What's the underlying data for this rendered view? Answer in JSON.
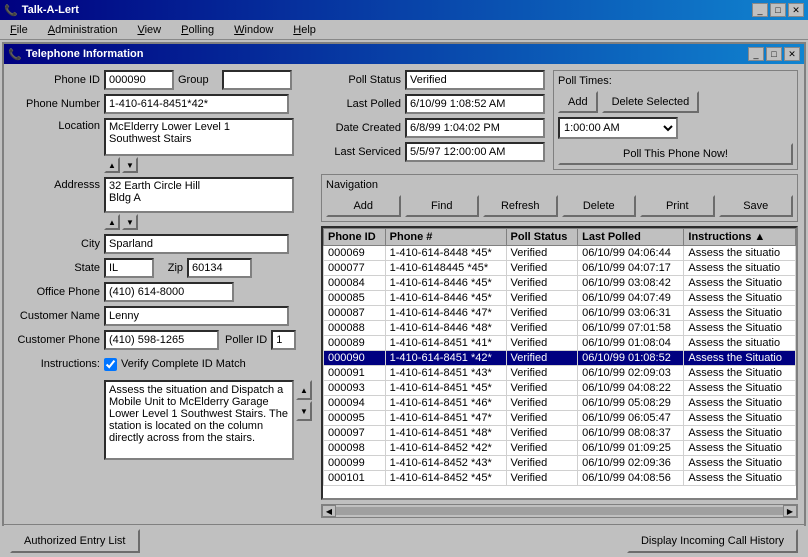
{
  "app": {
    "title": "Talk-A-Lert",
    "menu": [
      "File",
      "Administration",
      "View",
      "Polling",
      "Window",
      "Help"
    ]
  },
  "window": {
    "title": "Telephone Information"
  },
  "form": {
    "phone_id_label": "Phone ID",
    "phone_id_value": "000090",
    "group_label": "Group",
    "group_value": "",
    "phone_number_label": "Phone Number",
    "phone_number_value": "1-410-614-8451*42*",
    "location_label": "Location",
    "location_value": "McElderry Lower Level 1\nSouthwest Stairs",
    "address_label": "Addresss",
    "address_value": "32 Earth Circle Hill\nBldg A",
    "city_label": "City",
    "city_value": "Sparland",
    "state_label": "State",
    "state_value": "IL",
    "zip_label": "Zip",
    "zip_value": "60134",
    "office_phone_label": "Office Phone",
    "office_phone_value": "(410) 614-8000",
    "customer_name_label": "Customer Name",
    "customer_name_value": "Lenny",
    "customer_phone_label": "Customer Phone",
    "customer_phone_value": "(410) 598-1265",
    "poller_id_label": "Poller ID",
    "poller_id_value": "1",
    "instructions_label": "Instructions:",
    "verify_label": "Verify Complete ID Match",
    "verify_checked": true,
    "instructions_text": "Assess the situation and Dispatch a Mobile Unit to McElderry Garage Lower Level 1 Southwest Stairs. The station is located on the column directly across from the stairs."
  },
  "poll": {
    "status_label": "Poll Status",
    "status_value": "Verified",
    "last_polled_label": "Last Polled",
    "last_polled_value": "6/10/99 1:08:52 AM",
    "date_created_label": "Date Created",
    "date_created_value": "6/8/99 1:04:02 PM",
    "last_serviced_label": "Last Serviced",
    "last_serviced_value": "5/5/97 12:00:00 AM",
    "poll_times_title": "Poll Times:",
    "add_btn": "Add",
    "delete_selected_btn": "Delete Selected",
    "time_value": "1:00:00 AM",
    "poll_now_btn": "Poll This Phone Now!"
  },
  "nav": {
    "title": "Navigation",
    "add": "Add",
    "find": "Find",
    "refresh": "Refresh",
    "delete": "Delete",
    "print": "Print",
    "save": "Save"
  },
  "table": {
    "columns": [
      "Phone ID",
      "Phone #",
      "Poll Status",
      "Last Polled",
      "Instructions"
    ],
    "rows": [
      {
        "id": "000069",
        "phone": "1-410-614-8448 *45*",
        "status": "Verified",
        "polled": "06/10/99 04:06:44",
        "instructions": "Assess the situatio"
      },
      {
        "id": "000077",
        "phone": "1-410-6148445 *45*",
        "status": "Verified",
        "polled": "06/10/99 04:07:17",
        "instructions": "Assess the situatio"
      },
      {
        "id": "000084",
        "phone": "1-410-614-8446 *45*",
        "status": "Verified",
        "polled": "06/10/99 03:08:42",
        "instructions": "Assess the Situatio"
      },
      {
        "id": "000085",
        "phone": "1-410-614-8446 *45*",
        "status": "Verified",
        "polled": "06/10/99 04:07:49",
        "instructions": "Assess the Situatio"
      },
      {
        "id": "000087",
        "phone": "1-410-614-8446 *47*",
        "status": "Verified",
        "polled": "06/10/99 03:06:31",
        "instructions": "Assess the Situatio"
      },
      {
        "id": "000088",
        "phone": "1-410-614-8446 *48*",
        "status": "Verified",
        "polled": "06/10/99 07:01:58",
        "instructions": "Assess the Situatio"
      },
      {
        "id": "000089",
        "phone": "1-410-614-8451 *41*",
        "status": "Verified",
        "polled": "06/10/99 01:08:04",
        "instructions": "Assess the situatio"
      },
      {
        "id": "000090",
        "phone": "1-410-614-8451 *42*",
        "status": "Verified",
        "polled": "06/10/99 01:08:52",
        "instructions": "Assess the Situatio"
      },
      {
        "id": "000091",
        "phone": "1-410-614-8451 *43*",
        "status": "Verified",
        "polled": "06/10/99 02:09:03",
        "instructions": "Assess the Situatio"
      },
      {
        "id": "000093",
        "phone": "1-410-614-8451 *45*",
        "status": "Verified",
        "polled": "06/10/99 04:08:22",
        "instructions": "Assess the Situatio"
      },
      {
        "id": "000094",
        "phone": "1-410-614-8451 *46*",
        "status": "Verified",
        "polled": "06/10/99 05:08:29",
        "instructions": "Assess the Situatio"
      },
      {
        "id": "000095",
        "phone": "1-410-614-8451 *47*",
        "status": "Verified",
        "polled": "06/10/99 06:05:47",
        "instructions": "Assess the Situatio"
      },
      {
        "id": "000097",
        "phone": "1-410-614-8451 *48*",
        "status": "Verified",
        "polled": "06/10/99 08:08:37",
        "instructions": "Assess the Situatio"
      },
      {
        "id": "000098",
        "phone": "1-410-614-8452 *42*",
        "status": "Verified",
        "polled": "06/10/99 01:09:25",
        "instructions": "Assess the Situatio"
      },
      {
        "id": "000099",
        "phone": "1-410-614-8452 *43*",
        "status": "Verified",
        "polled": "06/10/99 02:09:36",
        "instructions": "Assess the Situatio"
      },
      {
        "id": "000101",
        "phone": "1-410-614-8452 *45*",
        "status": "Verified",
        "polled": "06/10/99 04:08:56",
        "instructions": "Assess the Situatio"
      }
    ]
  },
  "bottom": {
    "authorized_entry_btn": "Authorized Entry List",
    "incoming_call_btn": "Display Incoming Call History"
  },
  "colors": {
    "title_bar": "#000080",
    "selected_row": "#000080"
  }
}
